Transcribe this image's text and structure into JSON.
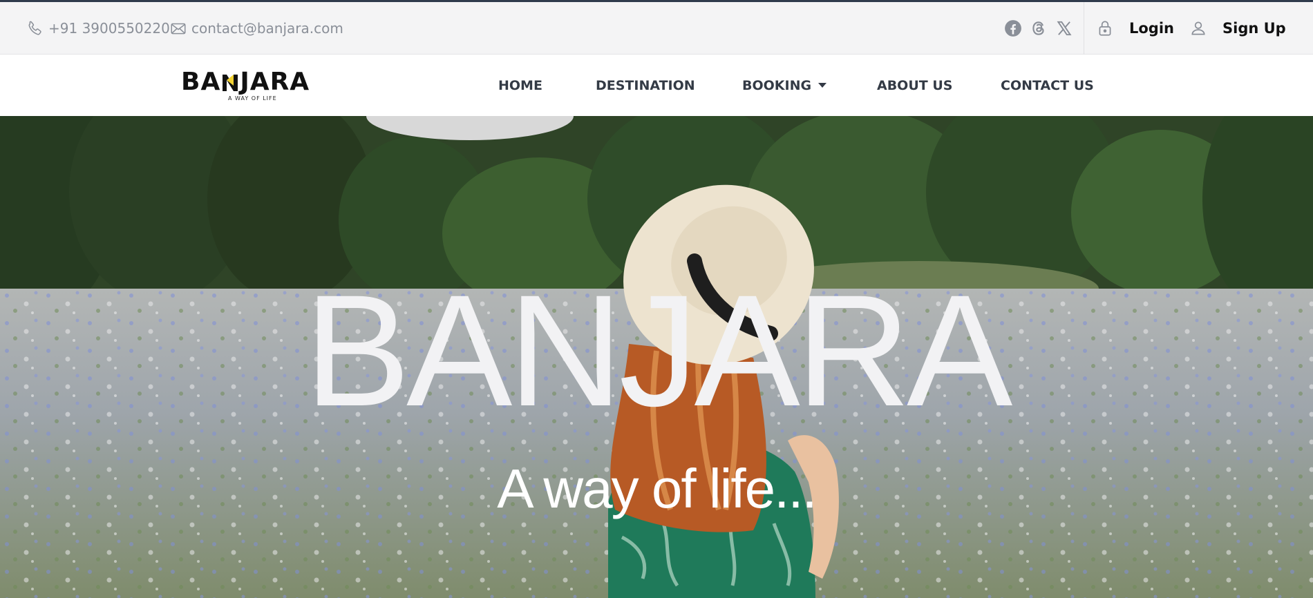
{
  "topbar": {
    "phone": "+91 3900550220",
    "email": "contact@banjara.com",
    "social": [
      "facebook-icon",
      "threads-icon",
      "x-icon"
    ],
    "login_label": "Login",
    "signup_label": "Sign Up"
  },
  "brand": {
    "name_left": "BA",
    "name_right": "JARA",
    "tagline": "A WAY OF LIFE",
    "accent_color": "#f2d233"
  },
  "nav": {
    "items": [
      {
        "label": "HOME"
      },
      {
        "label": "DESTINATION"
      },
      {
        "label": "BOOKING",
        "has_dropdown": true
      },
      {
        "label": "ABOUT US"
      },
      {
        "label": "CONTACT US"
      }
    ]
  },
  "hero": {
    "title": "BANJARA",
    "subtitle": "A way of life..."
  },
  "colors": {
    "topbar_bg": "#f4f4f5",
    "nav_text": "#333a45",
    "muted_text": "#8a8f98"
  }
}
